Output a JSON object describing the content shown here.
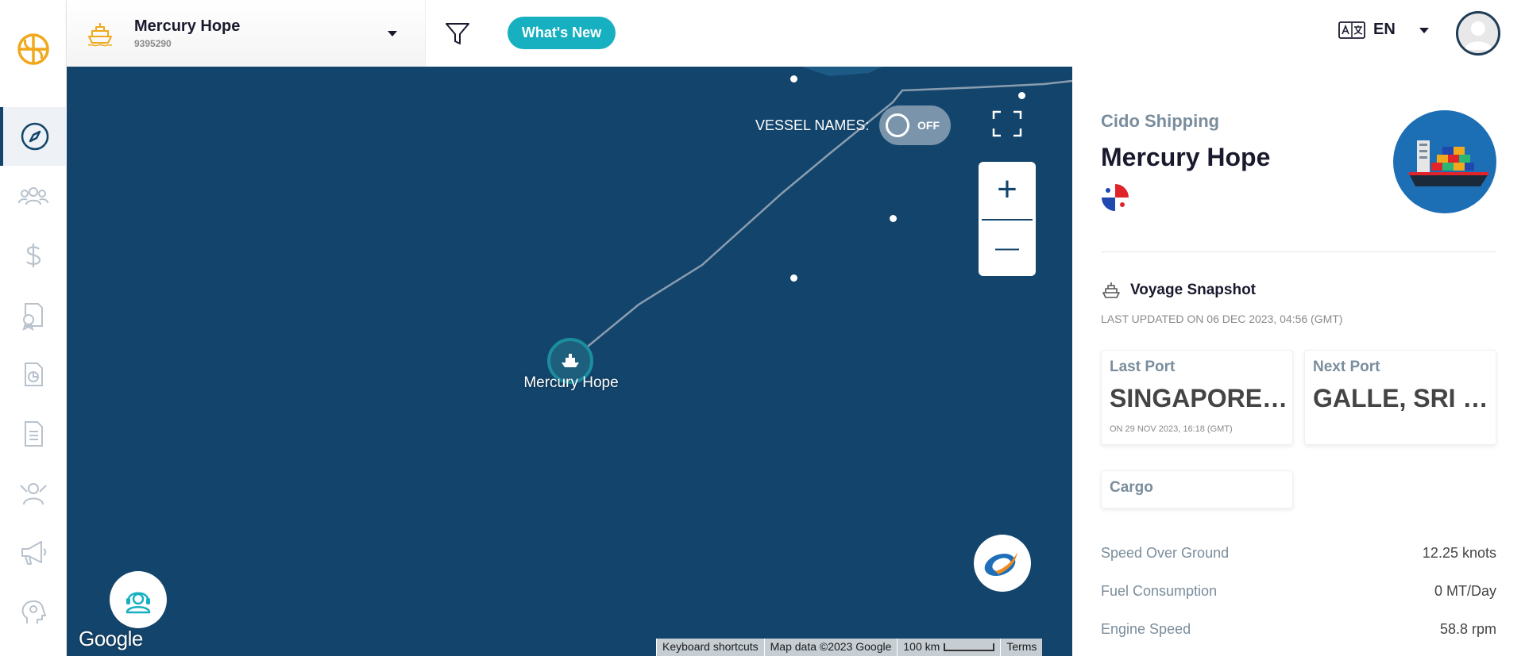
{
  "header": {
    "vessel_name": "Mercury Hope",
    "vessel_imo": "9395290",
    "whats_new": "What's New",
    "language": "EN"
  },
  "map": {
    "vessel_names_label": "VESSEL NAMES:",
    "vessel_names_state": "OFF",
    "zoom_in": "+",
    "zoom_out": "—",
    "vessel_label": "Mercury Hope",
    "google_logo": "Google",
    "attribution": {
      "shortcuts": "Keyboard shortcuts",
      "map_data": "Map data ©2023 Google",
      "scale": "100 km",
      "terms": "Terms"
    }
  },
  "panel": {
    "company": "Cido Shipping",
    "vessel_name": "Mercury Hope",
    "snapshot_title": "Voyage Snapshot",
    "last_updated": "LAST UPDATED ON 06 DEC 2023, 04:56 (GMT)",
    "last_port": {
      "label": "Last Port",
      "value": "SINGAPORE, SINGAPORE",
      "date": "ON 29 NOV 2023, 16:18 (GMT)"
    },
    "next_port": {
      "label": "Next Port",
      "value": "GALLE, SRI LANKA"
    },
    "cargo": {
      "label": "Cargo"
    },
    "stats": [
      {
        "label": "Speed Over Ground",
        "value": "12.25 knots"
      },
      {
        "label": "Fuel Consumption",
        "value": "0 MT/Day"
      },
      {
        "label": "Engine Speed",
        "value": "58.8 rpm"
      }
    ]
  },
  "colors": {
    "brand_navy": "#13446b",
    "accent_teal": "#17b0c0",
    "logo_gold": "#f0a81c"
  },
  "icons": {
    "sidebar": [
      "compass-icon",
      "users-icon",
      "dollar-icon",
      "certificate-icon",
      "report-icon",
      "document-icon",
      "crew-icon",
      "megaphone-icon",
      "brain-icon"
    ]
  }
}
